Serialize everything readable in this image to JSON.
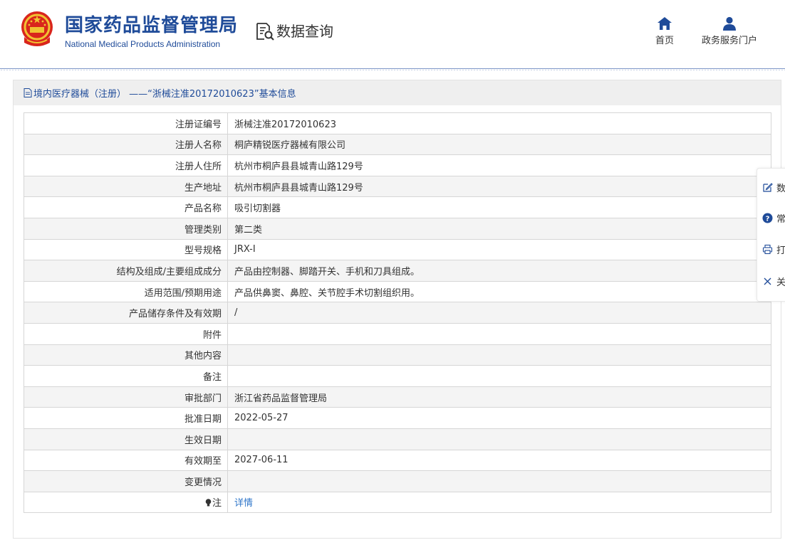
{
  "header": {
    "title_cn": "国家药品监督管理局",
    "title_en": "National Medical Products Administration",
    "query_label": "数据查询",
    "nav": {
      "home": "首页",
      "portal": "政务服务门户"
    }
  },
  "panel": {
    "title": "境内医疗器械（注册） ——“浙械注准20172010623”基本信息",
    "rows": [
      {
        "label": "注册证编号",
        "value": "浙械注准20172010623"
      },
      {
        "label": "注册人名称",
        "value": "桐庐精锐医疗器械有限公司"
      },
      {
        "label": "注册人住所",
        "value": "杭州市桐庐县县城青山路129号"
      },
      {
        "label": "生产地址",
        "value": "杭州市桐庐县县城青山路129号"
      },
      {
        "label": "产品名称",
        "value": "吸引切割器"
      },
      {
        "label": "管理类别",
        "value": "第二类"
      },
      {
        "label": "型号规格",
        "value": "JRX-I"
      },
      {
        "label": "结构及组成/主要组成成分",
        "value": "产品由控制器、脚踏开关、手机和刀具组成。"
      },
      {
        "label": "适用范围/预期用途",
        "value": "产品供鼻窦、鼻腔、关节腔手术切割组织用。"
      },
      {
        "label": "产品储存条件及有效期",
        "value": "/"
      },
      {
        "label": "附件",
        "value": ""
      },
      {
        "label": "其他内容",
        "value": ""
      },
      {
        "label": "备注",
        "value": ""
      },
      {
        "label": "审批部门",
        "value": "浙江省药品监督管理局"
      },
      {
        "label": "批准日期",
        "value": "2022-05-27"
      },
      {
        "label": "生效日期",
        "value": ""
      },
      {
        "label": "有效期至",
        "value": "2027-06-11"
      },
      {
        "label": "变更情况",
        "value": ""
      }
    ],
    "note_label": "注",
    "note_link": "详情"
  },
  "sidebar": {
    "items": [
      {
        "label": "数",
        "icon": "edit-icon"
      },
      {
        "label": "常",
        "icon": "help-icon"
      },
      {
        "label": "打",
        "icon": "print-icon"
      },
      {
        "label": "关",
        "icon": "close-icon"
      }
    ]
  },
  "colors": {
    "brand": "#1f4b99",
    "link": "#2e75c9",
    "header_bg": "#efefef",
    "row_alt": "#f4f4f4"
  }
}
